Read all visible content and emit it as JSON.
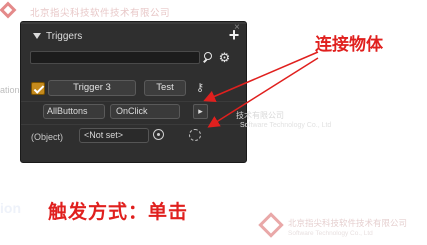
{
  "watermark": {
    "company_cn": "北京指尖科技软件技术有限公司",
    "company_cn_short": "技术有限公司",
    "company_en_short": "Software Technology Co., Ltd"
  },
  "panel": {
    "title": "Triggers",
    "close_glyph": "×",
    "add_glyph": "+",
    "search_placeholder": "",
    "trigger_button_label": "Trigger 3",
    "test_button_label": "Test",
    "row2_label": "ation",
    "event_source_value": "AllButtons",
    "event_type_value": "OnClick",
    "small_button_label": "▸",
    "object_label": "(Object)",
    "object_field_value": "<Not set>"
  },
  "annotations": {
    "connect_object": "连接物体",
    "trigger_mode": "触发方式：单击",
    "left_watermark": "ion"
  },
  "colors": {
    "annotation_red": "#e0201e",
    "panel_bg": "#2f2f2f",
    "checkbox_orange": "#c58a1c"
  }
}
